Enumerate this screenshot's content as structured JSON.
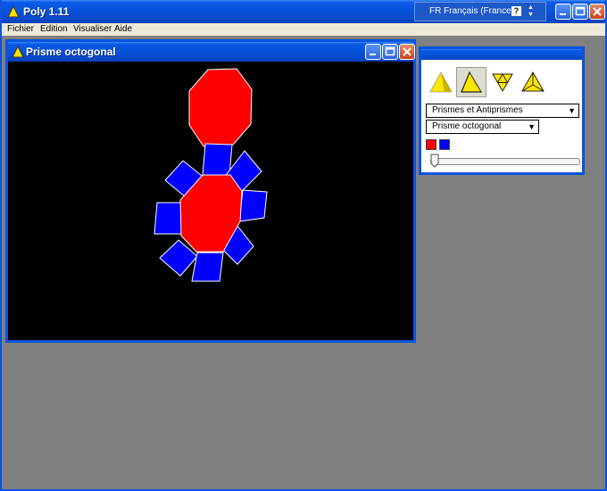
{
  "app": {
    "title": "Poly 1.11",
    "language": "FR Français (France)",
    "help_glyph": "?"
  },
  "menu": [
    "Fichier",
    "Edition",
    "Visualiser",
    "Aide"
  ],
  "sub_window": {
    "title": "Prisme octogonal"
  },
  "panel": {
    "family_select": "Prismes et Antiprismes",
    "polyhedron_select": "Prisme octogonal",
    "colors": [
      "#ff0000",
      "#0000ff"
    ],
    "tools": [
      "solid-view",
      "partial-unfold",
      "flat-net",
      "vertex-view"
    ],
    "active_tool": 1,
    "slider_value": 0
  },
  "colors": {
    "titlebar": "#0a54e0",
    "face_octagon": "#ff0000",
    "face_square": "#0000ff",
    "canvas_bg": "#000000",
    "desktop": "#808080"
  }
}
